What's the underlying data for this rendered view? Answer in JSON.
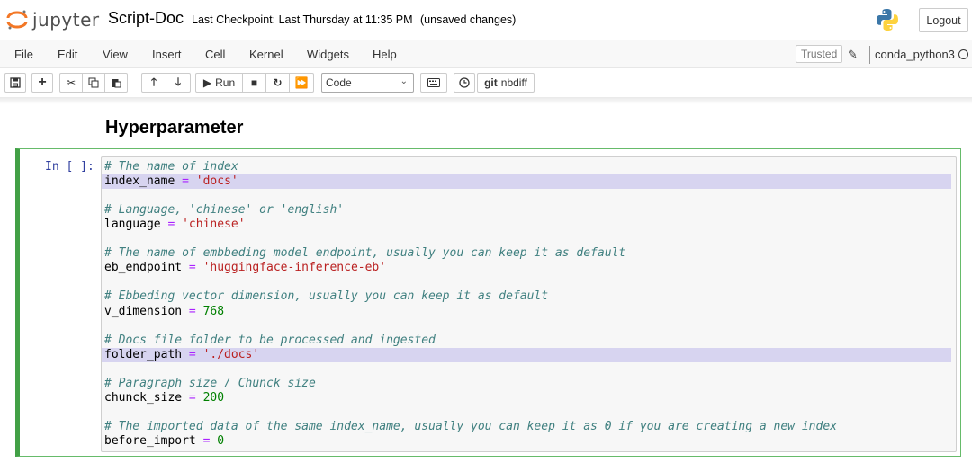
{
  "header": {
    "logo_text": "jupyter",
    "notebook_name": "Script-Doc",
    "checkpoint": "Last Checkpoint: Last Thursday at 11:35 PM",
    "unsaved": "(unsaved changes)",
    "logout": "Logout"
  },
  "menu": {
    "items": [
      "File",
      "Edit",
      "View",
      "Insert",
      "Cell",
      "Kernel",
      "Widgets",
      "Help"
    ],
    "trusted": "Trusted",
    "kernel": "conda_python3"
  },
  "toolbar": {
    "run_label": "Run",
    "cell_type": "Code",
    "nbdiff_label": "nbdiff",
    "git_label": "git"
  },
  "notebook": {
    "heading": "Hyperparameter",
    "prompt": "In [ ]:",
    "code": [
      {
        "comment": "# The name of index"
      },
      {
        "var": "index_name",
        "op": "=",
        "str": "'docs'",
        "highlight": true
      },
      {
        "blank": true
      },
      {
        "comment": "# Language, 'chinese' or 'english'"
      },
      {
        "var": "language",
        "op": "=",
        "str": "'chinese'"
      },
      {
        "blank": true
      },
      {
        "comment": "# The name of embbeding model endpoint, usually you can keep it as default"
      },
      {
        "var": "eb_endpoint",
        "op": "=",
        "str": "'huggingface-inference-eb'"
      },
      {
        "blank": true
      },
      {
        "comment": "# Ebbeding vector dimension, usually you can keep it as default"
      },
      {
        "var": "v_dimension",
        "op": "=",
        "num": "768"
      },
      {
        "blank": true
      },
      {
        "comment": "# Docs file folder to be processed and ingested"
      },
      {
        "var": "folder_path",
        "op": "=",
        "str": "'./docs'",
        "highlight": true
      },
      {
        "blank": true
      },
      {
        "comment": "# Paragraph size / Chunck size"
      },
      {
        "var": "chunck_size",
        "op": "=",
        "num": "200"
      },
      {
        "blank": true
      },
      {
        "comment": "# The imported data of the same index_name, usually you can keep it as 0 if you are creating a new index"
      },
      {
        "var": "before_import",
        "op": "=",
        "num": "0"
      }
    ]
  },
  "colors": {
    "comment": "#408080",
    "operator": "#aa22ff",
    "string": "#ba2121",
    "number": "#008000",
    "cell_border": "#42a046",
    "highlight": "#d7d4f0",
    "prompt": "#303f9f"
  }
}
